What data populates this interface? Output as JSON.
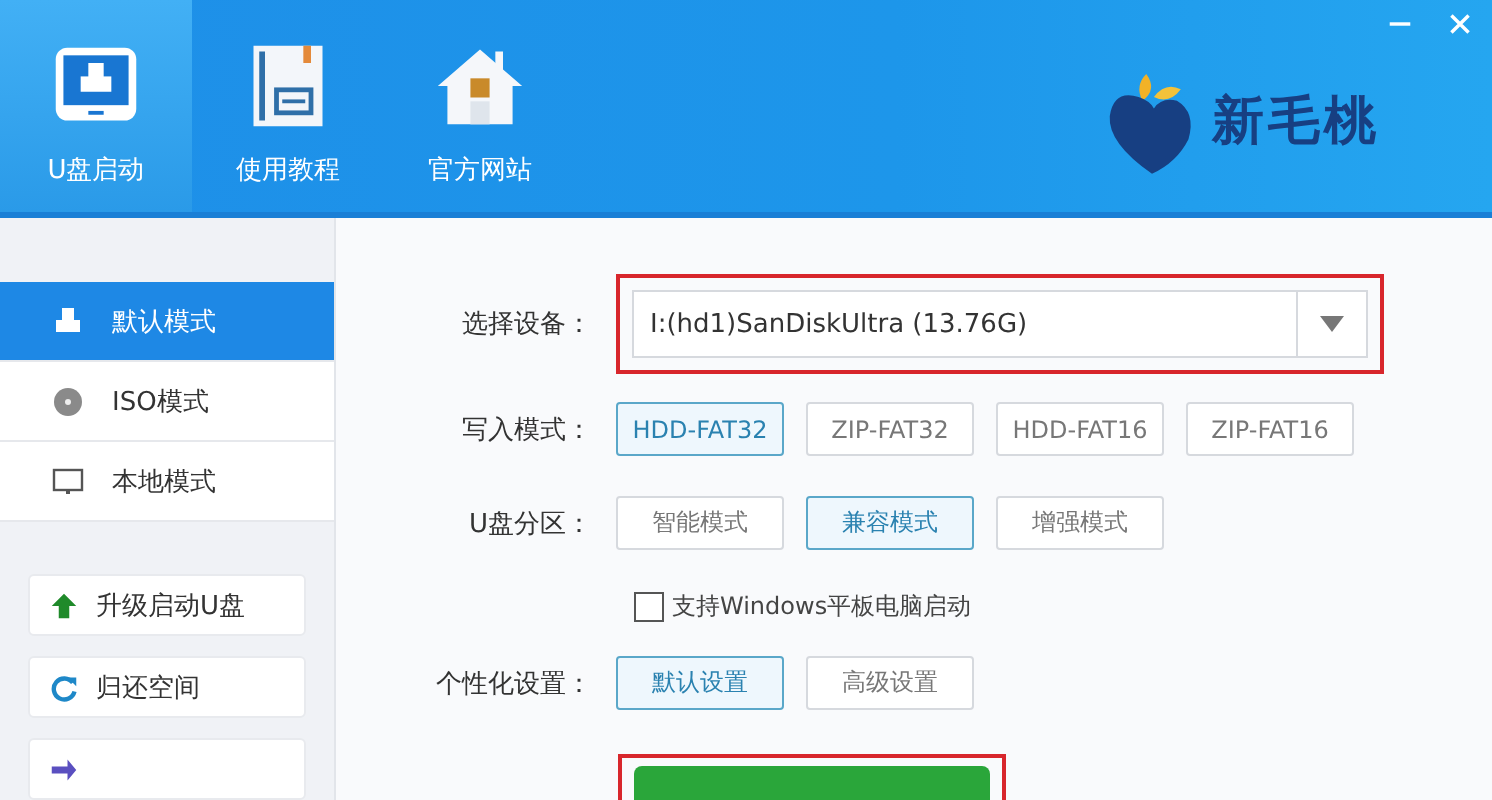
{
  "header": {
    "nav": [
      {
        "label": "U盘启动",
        "kind": "usb",
        "selected": true
      },
      {
        "label": "使用教程",
        "kind": "tutorial",
        "selected": false
      },
      {
        "label": "官方网站",
        "kind": "website",
        "selected": false
      }
    ],
    "brand": "新毛桃"
  },
  "sidebar": {
    "modes": [
      {
        "label": "默认模式",
        "kind": "default",
        "selected": true
      },
      {
        "label": "ISO模式",
        "kind": "iso",
        "selected": false
      },
      {
        "label": "本地模式",
        "kind": "local",
        "selected": false
      }
    ],
    "tools": [
      {
        "label": "升级启动U盘",
        "kind": "upgrade"
      },
      {
        "label": "归还空间",
        "kind": "restore"
      },
      {
        "kind": "convert"
      }
    ]
  },
  "form": {
    "device": {
      "label": "选择设备：",
      "value": "I:(hd1)SanDiskUltra (13.76G)"
    },
    "write_mode": {
      "label": "写入模式：",
      "options": [
        {
          "label": "HDD-FAT32",
          "selected": true
        },
        {
          "label": "ZIP-FAT32",
          "selected": false
        },
        {
          "label": "HDD-FAT16",
          "selected": false
        },
        {
          "label": "ZIP-FAT16",
          "selected": false
        }
      ]
    },
    "partition": {
      "label": "U盘分区：",
      "options": [
        {
          "label": "智能模式",
          "selected": false
        },
        {
          "label": "兼容模式",
          "selected": true
        },
        {
          "label": "增强模式",
          "selected": false
        }
      ]
    },
    "tablet_boot": {
      "label": "支持Windows平板电脑启动",
      "checked": false
    },
    "personalize": {
      "label": "个性化设置：",
      "options": [
        {
          "label": "默认设置",
          "selected": true
        },
        {
          "label": "高级设置",
          "selected": false
        }
      ]
    }
  }
}
